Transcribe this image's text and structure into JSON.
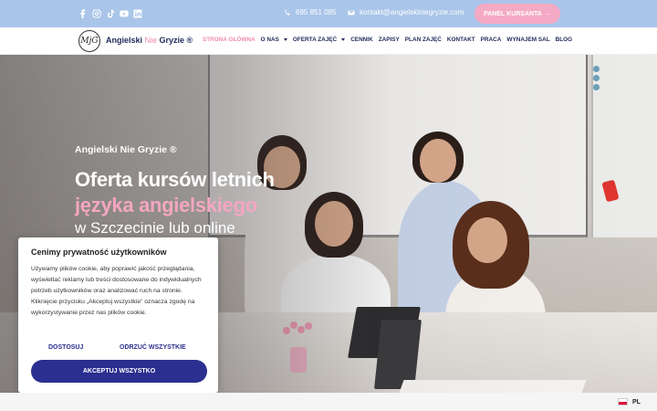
{
  "topbar": {
    "socials": [
      {
        "name": "facebook-icon"
      },
      {
        "name": "instagram-icon"
      },
      {
        "name": "tiktok-icon"
      },
      {
        "name": "youtube-icon"
      },
      {
        "name": "linkedin-icon"
      }
    ],
    "phone": "695 851 085",
    "email": "kontakt@angielskiniegryzie.com",
    "panel_button": "PANEL KURSANTA"
  },
  "header": {
    "logo_mark": "MjG",
    "brand_part1": "Angielski ",
    "brand_part2": "Nie",
    "brand_part3": " Gryzie ®",
    "nav": [
      {
        "label": "STRONA GŁÓWNA",
        "active": true,
        "dropdown": false
      },
      {
        "label": "O NAS",
        "active": false,
        "dropdown": true
      },
      {
        "label": "OFERTA ZAJĘĆ",
        "active": false,
        "dropdown": true
      },
      {
        "label": "CENNIK",
        "active": false,
        "dropdown": false
      },
      {
        "label": "ZAPISY",
        "active": false,
        "dropdown": false
      },
      {
        "label": "PLAN ZAJĘĆ",
        "active": false,
        "dropdown": false
      },
      {
        "label": "KONTAKT",
        "active": false,
        "dropdown": false
      },
      {
        "label": "PRACA",
        "active": false,
        "dropdown": false
      },
      {
        "label": "WYNAJEM SAL",
        "active": false,
        "dropdown": false
      },
      {
        "label": "BLOG",
        "active": false,
        "dropdown": false
      }
    ]
  },
  "hero": {
    "subtitle": "Angielski Nie Gryzie ®",
    "title_line1": "Oferta kursów letnich",
    "title_line2": "języka angielskiego",
    "title_line3": "w Szczecinie lub online"
  },
  "cookie": {
    "title": "Cenimy prywatność użytkowników",
    "text": "Używamy plików cookie, aby poprawić jakość przeglądania, wyświetlać reklamy lub treści dostosowane do indywidualnych potrzeb użytkowników oraz analizować ruch na stronie. Kliknięcie przycisku „Akceptuj wszystkie” oznacza zgodę na wykorzystywanie przez nas plików cookie.",
    "customize": "DOSTOSUJ",
    "reject": "ODRZUĆ WSZYSTKIE",
    "accept": "AKCEPTUJ WSZYSTKO"
  },
  "language": {
    "code": "PL"
  },
  "colors": {
    "topbar": "#a9c5e9",
    "accent_pink": "#f4a9c4",
    "brand_navy": "#1f2a5a",
    "button_blue": "#2b2f8f"
  }
}
